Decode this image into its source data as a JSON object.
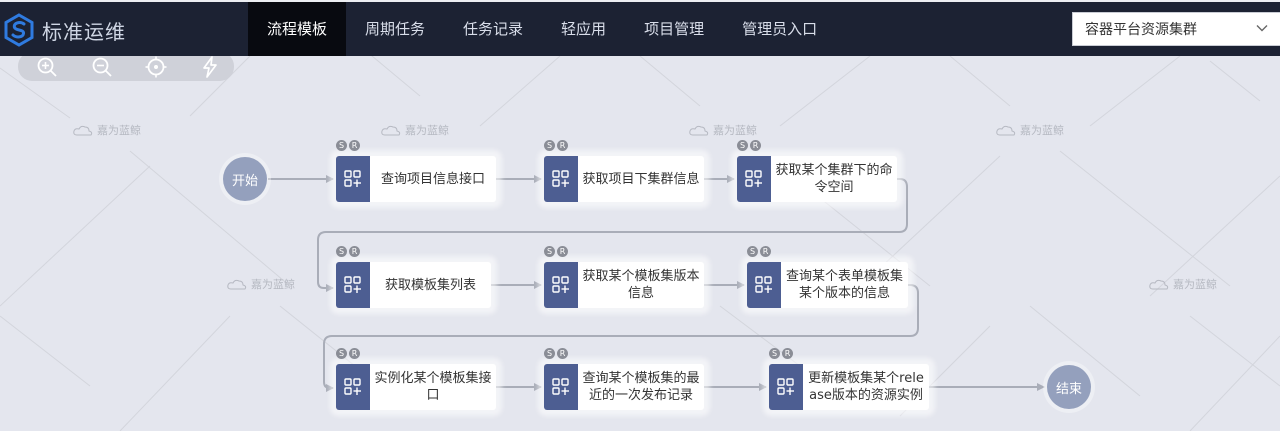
{
  "brand": {
    "name": "标准运维",
    "icon": "blue-s-logo-icon",
    "color": "#2f7be0"
  },
  "nav": {
    "items": [
      {
        "label": "流程模板",
        "active": true
      },
      {
        "label": "周期任务"
      },
      {
        "label": "任务记录"
      },
      {
        "label": "轻应用"
      },
      {
        "label": "项目管理"
      },
      {
        "label": "管理员入口"
      }
    ]
  },
  "cluster_select": {
    "value": "容器平台资源集群",
    "icon": "chevron-down-icon"
  },
  "toolbar": {
    "icons": [
      "zoom-in-icon",
      "zoom-out-icon",
      "locate-icon",
      "lightning-icon"
    ]
  },
  "watermark": {
    "text": "嘉为蓝鲸"
  },
  "flow": {
    "start": "开始",
    "end": "结束",
    "badges": [
      "S",
      "R"
    ],
    "node_icon": "plugin-grid-icon",
    "nodes": [
      {
        "label": "查询项目信息接口"
      },
      {
        "label": "获取项目下集群信息"
      },
      {
        "label": "获取某个集群下的命令空间"
      },
      {
        "label": "获取模板集列表"
      },
      {
        "label": "获取某个模板集版本信息"
      },
      {
        "label": "查询某个表单模板集某个版本的信息"
      },
      {
        "label": "实例化某个模板集接口"
      },
      {
        "label": "查询某个模板集的最近的一次发布记录"
      },
      {
        "label": "更新模板集某个release版本的资源实例"
      }
    ]
  },
  "colors": {
    "topbar": "#1c2233",
    "node_icon": "#4d5e92",
    "circle": "#94a0bd",
    "edge": "#a9adb8"
  }
}
